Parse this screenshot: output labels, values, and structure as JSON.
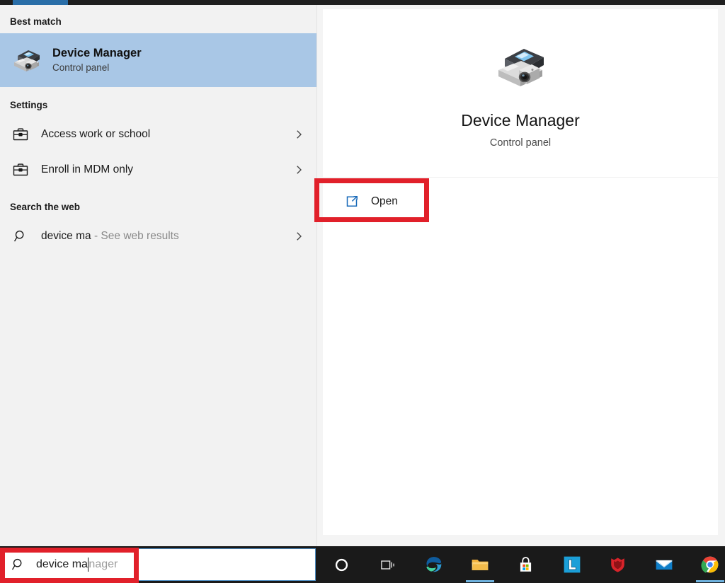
{
  "window": {
    "accent_color": "#2a6ea8",
    "panel_bg": "#f2f2f2",
    "card_bg": "#ffffff",
    "highlight_color": "#a9c7e6",
    "annotation_color": "#e1202a"
  },
  "left_pane": {
    "best_match_header": "Best match",
    "best_match": {
      "title": "Device Manager",
      "subtitle": "Control panel",
      "icon": "device-manager-icon"
    },
    "settings_header": "Settings",
    "settings_items": [
      {
        "label": "Access work or school",
        "icon": "briefcase-icon",
        "chevron": "chevron-right-icon"
      },
      {
        "label": "Enroll in MDM only",
        "icon": "briefcase-icon",
        "chevron": "chevron-right-icon"
      }
    ],
    "web_header": "Search the web",
    "web_items": [
      {
        "query": "device ma",
        "suffix": " - See web results",
        "icon": "search-icon",
        "chevron": "chevron-right-icon"
      }
    ]
  },
  "right_pane": {
    "preview": {
      "title": "Device Manager",
      "subtitle": "Control panel",
      "icon": "device-manager-icon"
    },
    "actions": [
      {
        "label": "Open",
        "icon": "open-external-icon",
        "highlighted": true
      }
    ]
  },
  "taskbar": {
    "search": {
      "typed_text": "device ma",
      "suggestion_text": "nager",
      "icon": "search-icon",
      "highlighted": true
    },
    "items": [
      {
        "name": "cortana-icon",
        "label": "Cortana",
        "running": false
      },
      {
        "name": "task-view-icon",
        "label": "Task View",
        "running": false
      },
      {
        "name": "edge-icon",
        "label": "Microsoft Edge",
        "running": false
      },
      {
        "name": "file-explorer-icon",
        "label": "File Explorer",
        "running": true
      },
      {
        "name": "microsoft-store-icon",
        "label": "Microsoft Store",
        "running": false
      },
      {
        "name": "app-l-icon",
        "label": "L",
        "running": false
      },
      {
        "name": "mcafee-icon",
        "label": "McAfee",
        "running": false
      },
      {
        "name": "mail-icon",
        "label": "Mail",
        "running": false
      },
      {
        "name": "chrome-icon",
        "label": "Google Chrome",
        "running": true
      }
    ]
  }
}
